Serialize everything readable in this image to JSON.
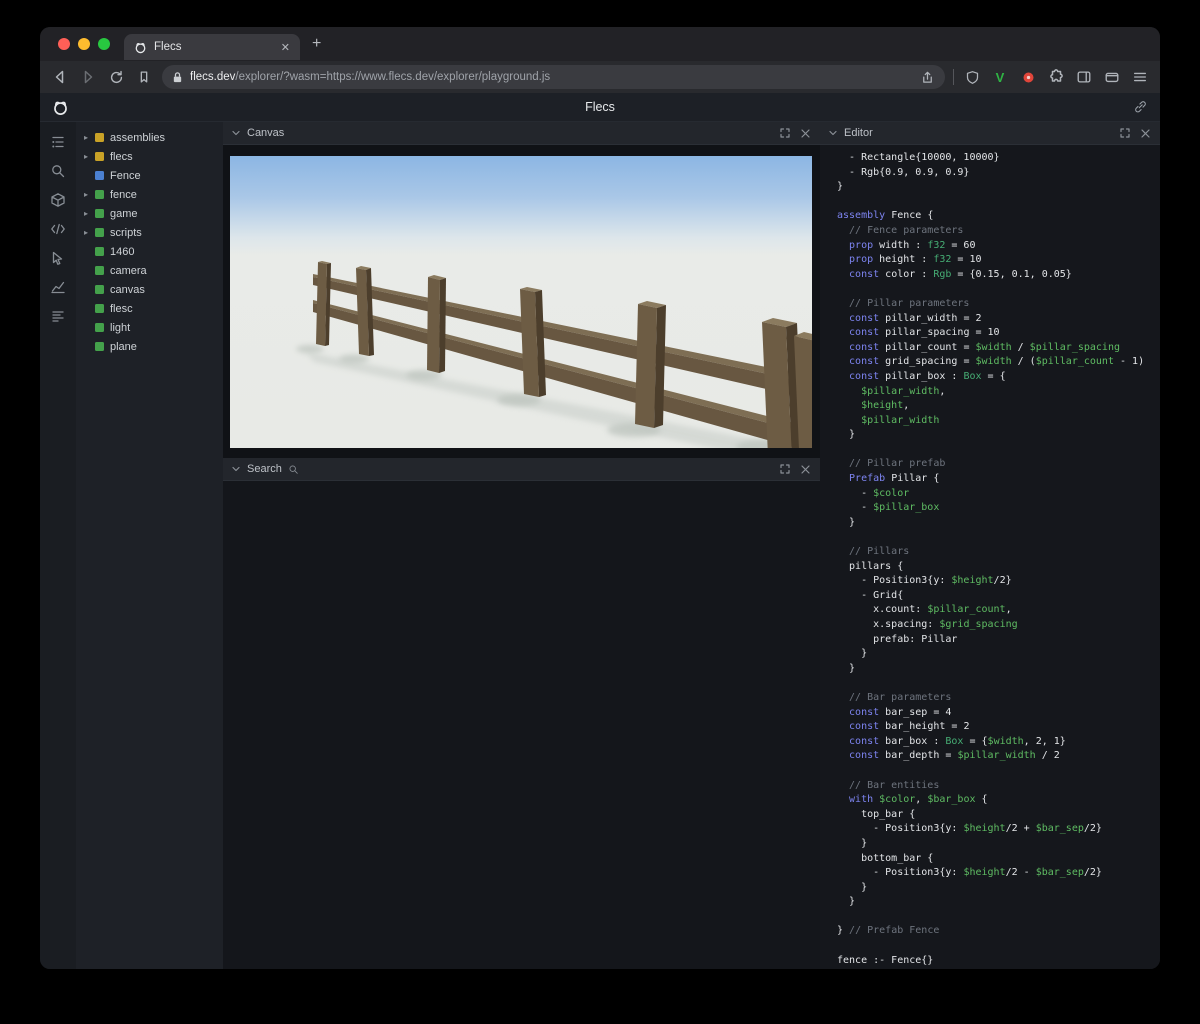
{
  "browser": {
    "tab_title": "Flecs",
    "url_domain": "flecs.dev",
    "url_path": "/explorer/?wasm=https://www.flecs.dev/explorer/playground.js",
    "v_badge": "V",
    "window_controls": {
      "close": "#ff5f57",
      "minimize": "#febc2e",
      "zoom": "#28c840"
    }
  },
  "header": {
    "title": "Flecs"
  },
  "tree": {
    "items": [
      {
        "label": "assemblies",
        "color": "#c9a227",
        "expandable": true
      },
      {
        "label": "flecs",
        "color": "#c9a227",
        "expandable": true
      },
      {
        "label": "Fence",
        "color": "#4b80d1",
        "expandable": false
      },
      {
        "label": "fence",
        "color": "#44a14b",
        "expandable": true
      },
      {
        "label": "game",
        "color": "#44a14b",
        "expandable": true
      },
      {
        "label": "scripts",
        "color": "#44a14b",
        "expandable": true
      },
      {
        "label": "1460",
        "color": "#44a14b",
        "expandable": false
      },
      {
        "label": "camera",
        "color": "#44a14b",
        "expandable": false
      },
      {
        "label": "canvas",
        "color": "#44a14b",
        "expandable": false
      },
      {
        "label": "flesc",
        "color": "#44a14b",
        "expandable": false
      },
      {
        "label": "light",
        "color": "#44a14b",
        "expandable": false
      },
      {
        "label": "plane",
        "color": "#44a14b",
        "expandable": false
      }
    ]
  },
  "panels": {
    "canvas": {
      "title": "Canvas"
    },
    "search": {
      "title": "Search"
    },
    "editor": {
      "title": "Editor"
    }
  },
  "editor": {
    "code": [
      [
        [
          "p",
          "  - Rectangle{10000, 10000}"
        ]
      ],
      [
        [
          "p",
          "  - Rgb{0.9, 0.9, 0.9}"
        ]
      ],
      [
        [
          "p",
          "}"
        ]
      ],
      [],
      [
        [
          "k",
          "assembly"
        ],
        [
          "p",
          " Fence {"
        ]
      ],
      [
        [
          "c",
          "  // Fence parameters"
        ]
      ],
      [
        [
          "k",
          "  prop"
        ],
        [
          "p",
          " width : "
        ],
        [
          "t",
          "f32"
        ],
        [
          "p",
          " = 60"
        ]
      ],
      [
        [
          "k",
          "  prop"
        ],
        [
          "p",
          " height : "
        ],
        [
          "t",
          "f32"
        ],
        [
          "p",
          " = 10"
        ]
      ],
      [
        [
          "k",
          "  const"
        ],
        [
          "p",
          " color : "
        ],
        [
          "t",
          "Rgb"
        ],
        [
          "p",
          " = {0.15, 0.1, 0.05}"
        ]
      ],
      [],
      [
        [
          "c",
          "  // Pillar parameters"
        ]
      ],
      [
        [
          "k",
          "  const"
        ],
        [
          "p",
          " pillar_width = 2"
        ]
      ],
      [
        [
          "k",
          "  const"
        ],
        [
          "p",
          " pillar_spacing = 10"
        ]
      ],
      [
        [
          "k",
          "  const"
        ],
        [
          "p",
          " pillar_count = "
        ],
        [
          "v",
          "$width"
        ],
        [
          "p",
          " / "
        ],
        [
          "v",
          "$pillar_spacing"
        ]
      ],
      [
        [
          "k",
          "  const"
        ],
        [
          "p",
          " grid_spacing = "
        ],
        [
          "v",
          "$width"
        ],
        [
          "p",
          " / ("
        ],
        [
          "v",
          "$pillar_count"
        ],
        [
          "p",
          " - 1)"
        ]
      ],
      [
        [
          "k",
          "  const"
        ],
        [
          "p",
          " pillar_box : "
        ],
        [
          "t",
          "Box"
        ],
        [
          "p",
          " = {"
        ]
      ],
      [
        [
          "v",
          "    $pillar_width"
        ],
        [
          "p",
          ","
        ]
      ],
      [
        [
          "v",
          "    $height"
        ],
        [
          "p",
          ","
        ]
      ],
      [
        [
          "v",
          "    $pillar_width"
        ]
      ],
      [
        [
          "p",
          "  }"
        ]
      ],
      [],
      [
        [
          "c",
          "  // Pillar prefab"
        ]
      ],
      [
        [
          "k",
          "  Prefab"
        ],
        [
          "p",
          " Pillar {"
        ]
      ],
      [
        [
          "p",
          "    - "
        ],
        [
          "v",
          "$color"
        ]
      ],
      [
        [
          "p",
          "    - "
        ],
        [
          "v",
          "$pillar_box"
        ]
      ],
      [
        [
          "p",
          "  }"
        ]
      ],
      [],
      [
        [
          "c",
          "  // Pillars"
        ]
      ],
      [
        [
          "p",
          "  pillars {"
        ]
      ],
      [
        [
          "p",
          "    - Position3{y: "
        ],
        [
          "v",
          "$height"
        ],
        [
          "p",
          "/2}"
        ]
      ],
      [
        [
          "p",
          "    - Grid{"
        ]
      ],
      [
        [
          "p",
          "      x.count: "
        ],
        [
          "v",
          "$pillar_count"
        ],
        [
          "p",
          ","
        ]
      ],
      [
        [
          "p",
          "      x.spacing: "
        ],
        [
          "v",
          "$grid_spacing"
        ]
      ],
      [
        [
          "p",
          "      prefab: Pillar"
        ]
      ],
      [
        [
          "p",
          "    }"
        ]
      ],
      [
        [
          "p",
          "  }"
        ]
      ],
      [],
      [
        [
          "c",
          "  // Bar parameters"
        ]
      ],
      [
        [
          "k",
          "  const"
        ],
        [
          "p",
          " bar_sep = 4"
        ]
      ],
      [
        [
          "k",
          "  const"
        ],
        [
          "p",
          " bar_height = 2"
        ]
      ],
      [
        [
          "k",
          "  const"
        ],
        [
          "p",
          " bar_box : "
        ],
        [
          "t",
          "Box"
        ],
        [
          "p",
          " = {"
        ],
        [
          "v",
          "$width"
        ],
        [
          "p",
          ", 2, 1}"
        ]
      ],
      [
        [
          "k",
          "  const"
        ],
        [
          "p",
          " bar_depth = "
        ],
        [
          "v",
          "$pillar_width"
        ],
        [
          "p",
          " / 2"
        ]
      ],
      [],
      [
        [
          "c",
          "  // Bar entities"
        ]
      ],
      [
        [
          "k",
          "  with"
        ],
        [
          "p",
          " "
        ],
        [
          "v",
          "$color"
        ],
        [
          "p",
          ", "
        ],
        [
          "v",
          "$bar_box"
        ],
        [
          "p",
          " {"
        ]
      ],
      [
        [
          "p",
          "    top_bar {"
        ]
      ],
      [
        [
          "p",
          "      - Position3{y: "
        ],
        [
          "v",
          "$height"
        ],
        [
          "p",
          "/2 + "
        ],
        [
          "v",
          "$bar_sep"
        ],
        [
          "p",
          "/2}"
        ]
      ],
      [
        [
          "p",
          "    }"
        ]
      ],
      [
        [
          "p",
          "    bottom_bar {"
        ]
      ],
      [
        [
          "p",
          "      - Position3{y: "
        ],
        [
          "v",
          "$height"
        ],
        [
          "p",
          "/2 - "
        ],
        [
          "v",
          "$bar_sep"
        ],
        [
          "p",
          "/2}"
        ]
      ],
      [
        [
          "p",
          "    }"
        ]
      ],
      [
        [
          "p",
          "  }"
        ]
      ],
      [],
      [
        [
          "p",
          "} "
        ],
        [
          "c",
          "// Prefab Fence"
        ]
      ],
      [],
      [
        [
          "p",
          "fence :- Fence{}"
        ]
      ]
    ]
  }
}
